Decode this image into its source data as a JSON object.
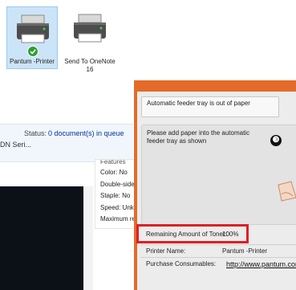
{
  "printers": [
    {
      "name": "Pantum -Printer",
      "selected": true,
      "status_icon": "green-check-icon"
    },
    {
      "name": "Send To OneNote 16",
      "selected": false
    }
  ],
  "queue": {
    "status_label": "Status:",
    "status_value": "0 document(s) in queue",
    "device_partial": "DN Seri..."
  },
  "features": {
    "header": "Features",
    "items": [
      "Color: No",
      "Double-sided",
      "Staple: No",
      "Speed: Unknown",
      "Maximum resolution"
    ]
  },
  "alert": {
    "title": "Automatic feeder tray is out of paper",
    "message": "Please add paper into the automatic feeder tray as shown",
    "step": "❸"
  },
  "toner": {
    "label": "Remaining Amount of Toner:",
    "value": "100%"
  },
  "printer_name": {
    "label": "Printer Name:",
    "value": "Pantum -Printer"
  },
  "consumables": {
    "label": "Purchase Consumables:",
    "link": "http://www.pantum.com"
  },
  "colors": {
    "accent": "#e46b2a",
    "highlight": "#e01e24",
    "selection": "#cce4f7"
  }
}
